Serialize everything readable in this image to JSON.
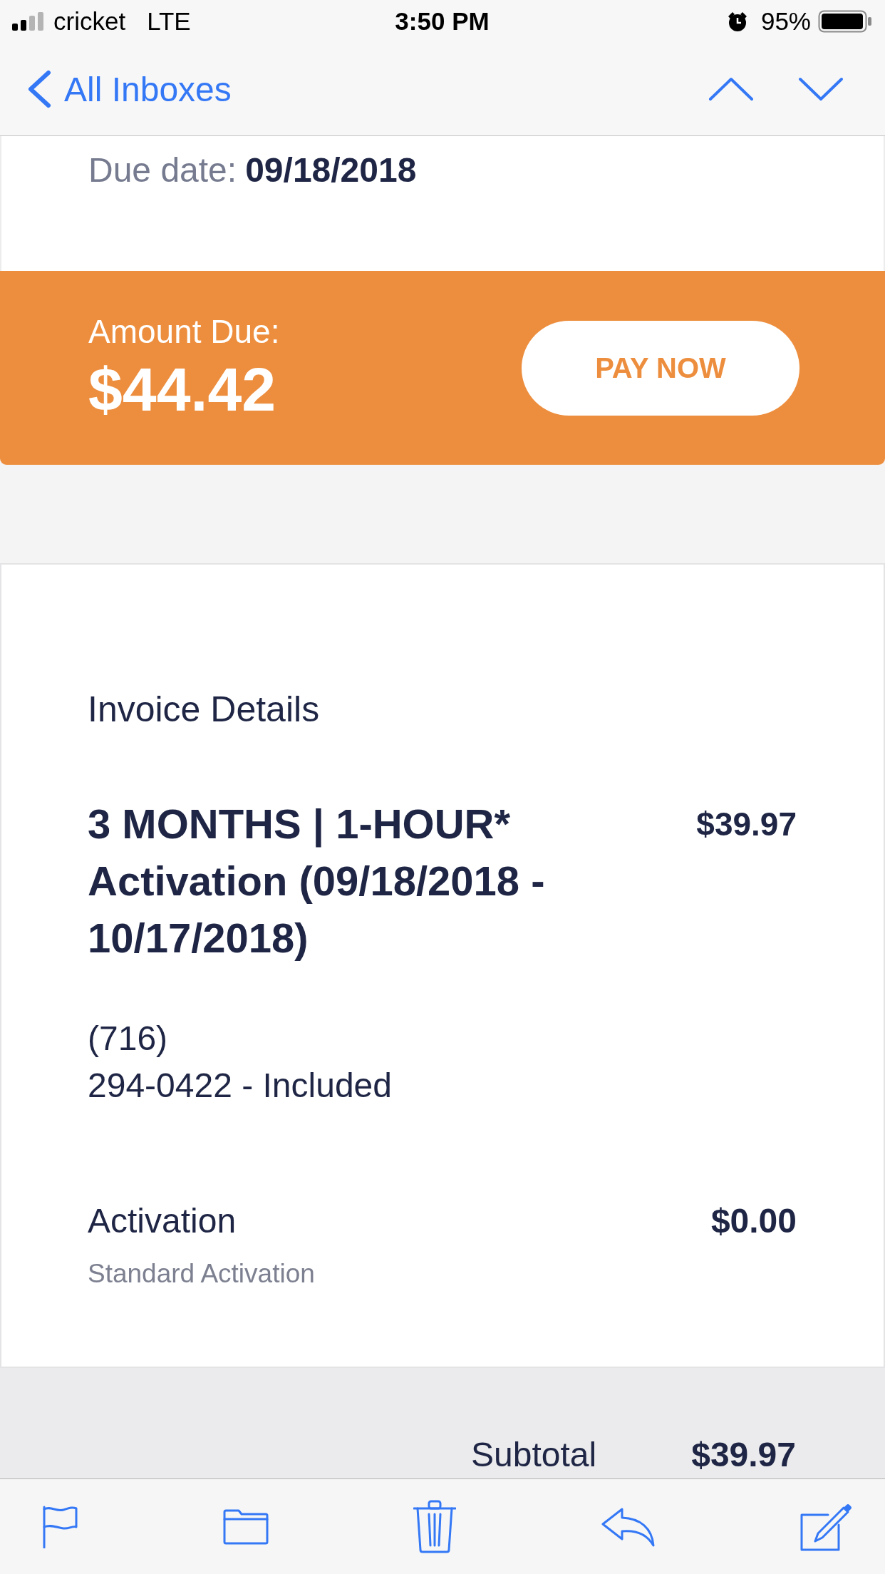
{
  "status_bar": {
    "carrier": "cricket",
    "network": "LTE",
    "time": "3:50 PM",
    "battery": "95%"
  },
  "nav_bar": {
    "back_label": "All Inboxes"
  },
  "due_date": {
    "label": "Due date:",
    "value": "09/18/2018"
  },
  "amount_due": {
    "label": "Amount Due:",
    "amount": "$44.42",
    "button": "PAY NOW"
  },
  "invoice": {
    "title": "Invoice Details",
    "items": [
      {
        "kind": "plan",
        "name": "3 MONTHS | 1-HOUR* Activation (09/18/2018 - 10/17/2018)",
        "price": "$39.97",
        "details": [
          "(716)",
          "294-0422 - Included"
        ]
      },
      {
        "kind": "fee",
        "name": "Activation",
        "price": "$0.00",
        "note": "Standard Activation"
      }
    ]
  },
  "summary": {
    "rows": [
      {
        "label": "Subtotal",
        "value": "$39.97"
      }
    ]
  }
}
